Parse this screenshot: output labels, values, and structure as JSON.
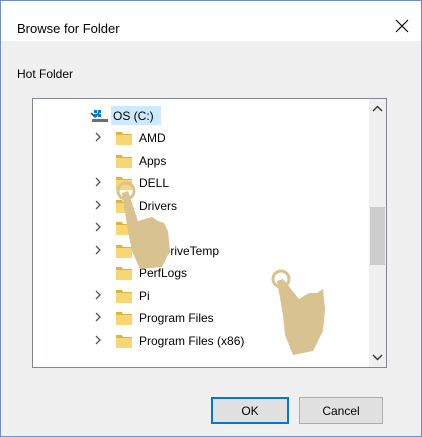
{
  "window": {
    "title": "Browse for Folder"
  },
  "description": "Hot Folder",
  "tree": {
    "root": {
      "label": "OS (C:)",
      "icon": "drive-icon"
    },
    "items": [
      {
        "label": "AMD",
        "icon": "folder-icon",
        "expandable": true
      },
      {
        "label": "Apps",
        "icon": "folder-icon",
        "expandable": false
      },
      {
        "label": "DELL",
        "icon": "folder-icon",
        "expandable": true
      },
      {
        "label": "Drivers",
        "icon": "folder-icon",
        "expandable": true
      },
      {
        "label": "",
        "icon": "folder-icon",
        "expandable": true
      },
      {
        "label": "OneDriveTemp",
        "icon": "folder-icon",
        "expandable": true
      },
      {
        "label": "PerfLogs",
        "icon": "folder-icon",
        "expandable": false
      },
      {
        "label": "Pi",
        "icon": "folder-icon",
        "expandable": true
      },
      {
        "label": "Program Files",
        "icon": "folder-icon",
        "expandable": true
      },
      {
        "label": "Program Files (x86)",
        "icon": "folder-icon",
        "expandable": true
      }
    ]
  },
  "buttons": {
    "ok": "OK",
    "cancel": "Cancel"
  },
  "colors": {
    "selection": "#cde8ff",
    "folder": "#f7d774",
    "folder_dark": "#e0b23e",
    "hand": "#d8c290",
    "accent": "#0078d7"
  }
}
